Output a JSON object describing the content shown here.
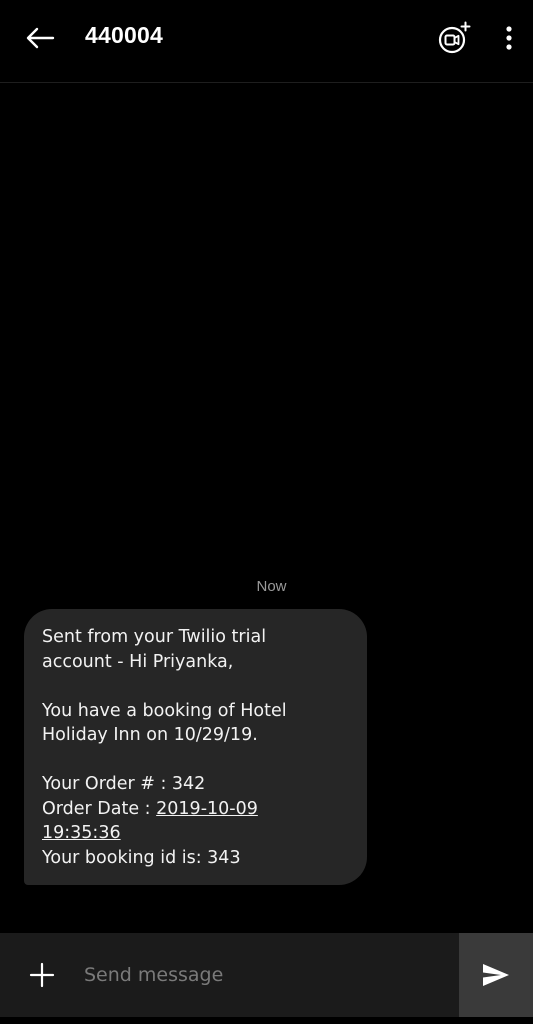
{
  "header": {
    "title": "440004",
    "icons": {
      "back": "arrow-left-icon",
      "video": "video-call-add-icon",
      "more": "more-vertical-icon"
    }
  },
  "conversation": {
    "timestamp": "Now",
    "messages": [
      {
        "direction": "incoming",
        "lines": {
          "l1": "Sent from your Twilio trial",
          "l2": "account - Hi Priyanka,",
          "l3": "You have a booking of Hotel",
          "l4": "Holiday Inn on 10/29/19.",
          "l5": "Your Order # : 342",
          "l6_prefix": "Order Date : ",
          "l6_link": "2019-10-09",
          "l7_link": "19:35:36",
          "l8": "Your booking id is: 343"
        }
      }
    ]
  },
  "composer": {
    "placeholder": "Send message",
    "icons": {
      "add": "plus-icon",
      "send": "send-icon"
    }
  },
  "colors": {
    "background": "#000000",
    "bubble": "#262626",
    "composer": "#1b1b1b",
    "send_button": "#3a3a3a",
    "timestamp": "#9a9a9a"
  }
}
